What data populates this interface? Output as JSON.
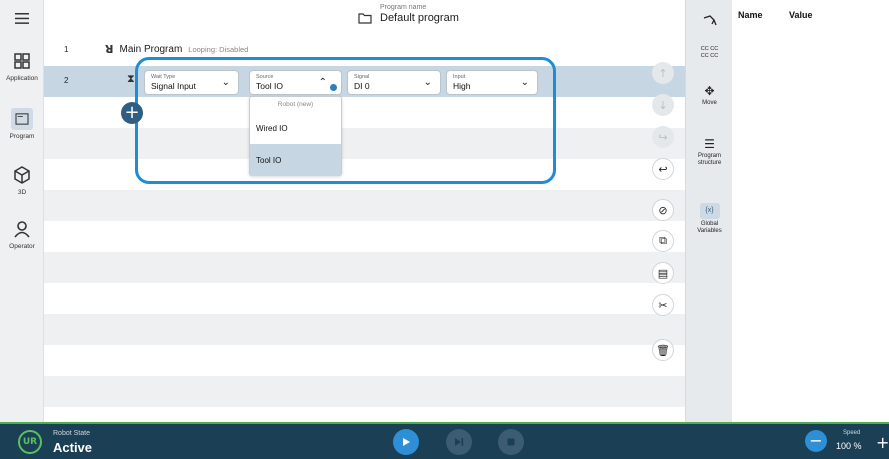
{
  "header": {
    "caption": "Program name",
    "title": "Default program"
  },
  "sidebar": {
    "items": [
      {
        "label": "Application",
        "icon": "grid-icon"
      },
      {
        "label": "Program",
        "icon": "program-icon"
      },
      {
        "label": "3D",
        "icon": "cube-icon"
      },
      {
        "label": "Operator",
        "icon": "person-icon"
      }
    ],
    "active": "Program"
  },
  "program": {
    "rows": [
      {
        "num": "1",
        "label": "Main Program",
        "looping": "Looping: Disabled"
      },
      {
        "num": "2"
      }
    ],
    "wait": {
      "wait_type": {
        "caption": "Wait Type",
        "value": "Signal Input"
      },
      "source": {
        "caption": "Source",
        "value": "Tool IO"
      },
      "signal": {
        "caption": "Signal",
        "value": "DI 0"
      },
      "input": {
        "caption": "Input",
        "value": "High"
      }
    },
    "dropdown": {
      "header": "Robot (new)",
      "options": [
        "Wired IO",
        "Tool IO"
      ],
      "selected": "Tool IO"
    }
  },
  "right_toolbar": {
    "items": [
      {
        "label": "",
        "icon": "robot-arm-icon"
      },
      {
        "label": "",
        "icon": "code-icon",
        "text": "CC CC\nCC CC"
      },
      {
        "label": "Move",
        "icon": "move-icon"
      },
      {
        "label": "Program\nstructure",
        "icon": "list-icon"
      },
      {
        "label": "Global\nVariables",
        "icon": "variables-icon",
        "text": "{x}"
      }
    ]
  },
  "variables_panel": {
    "name_header": "Name",
    "value_header": "Value"
  },
  "bottom_bar": {
    "robot_state_caption": "Robot State",
    "robot_state": "Active",
    "speed_caption": "Speed",
    "speed_value": "100 %",
    "accent": "#4caf50",
    "play_color": "#2e8fd6"
  }
}
